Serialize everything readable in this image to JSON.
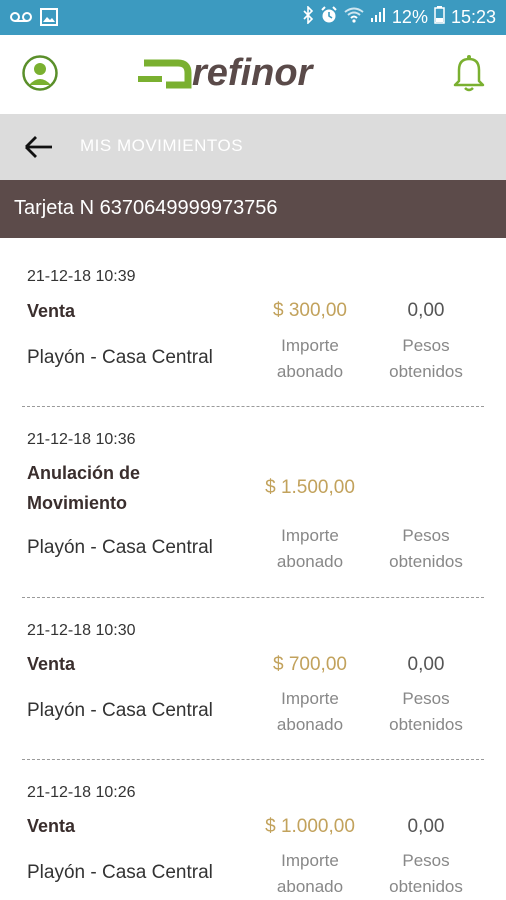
{
  "status_bar": {
    "battery": "12%",
    "time": "15:23",
    "icons": [
      "voicemail-icon",
      "image-icon",
      "bluetooth-icon",
      "alarm-icon",
      "wifi-icon",
      "signal-icon",
      "battery-icon"
    ],
    "color": "#3c9ac0"
  },
  "header": {
    "logo_text": "refinor",
    "brand_color": "#7ab030"
  },
  "title_bar": {
    "title": "MIS MOVIMIENTOS"
  },
  "card": {
    "label": "Tarjeta N 6370649999973756"
  },
  "movements": [
    {
      "date": "21-12-18 10:39",
      "type": "Venta",
      "amount": "$ 300,00",
      "points": "0,00",
      "place": "Playón - Casa Central",
      "amount_label_1": "Importe",
      "amount_label_2": "abonado",
      "points_label_1": "Pesos",
      "points_label_2": "obtenidos"
    },
    {
      "date": "21-12-18 10:36",
      "type_line1": "Anulación de",
      "type_line2": "Movimiento",
      "amount": "$ 1.500,00",
      "place": "Playón - Casa Central",
      "amount_label_1": "Importe",
      "amount_label_2": "abonado",
      "points_label_1": "Pesos",
      "points_label_2": "obtenidos"
    },
    {
      "date": "21-12-18 10:30",
      "type": "Venta",
      "amount": "$ 700,00",
      "points": "0,00",
      "place": "Playón - Casa Central",
      "amount_label_1": "Importe",
      "amount_label_2": "abonado",
      "points_label_1": "Pesos",
      "points_label_2": "obtenidos"
    },
    {
      "date": "21-12-18 10:26",
      "type": "Venta",
      "amount": "$ 1.000,00",
      "points": "0,00",
      "place": "Playón - Casa Central",
      "amount_label_1": "Importe",
      "amount_label_2": "abonado",
      "points_label_1": "Pesos",
      "points_label_2": "obtenidos"
    }
  ]
}
